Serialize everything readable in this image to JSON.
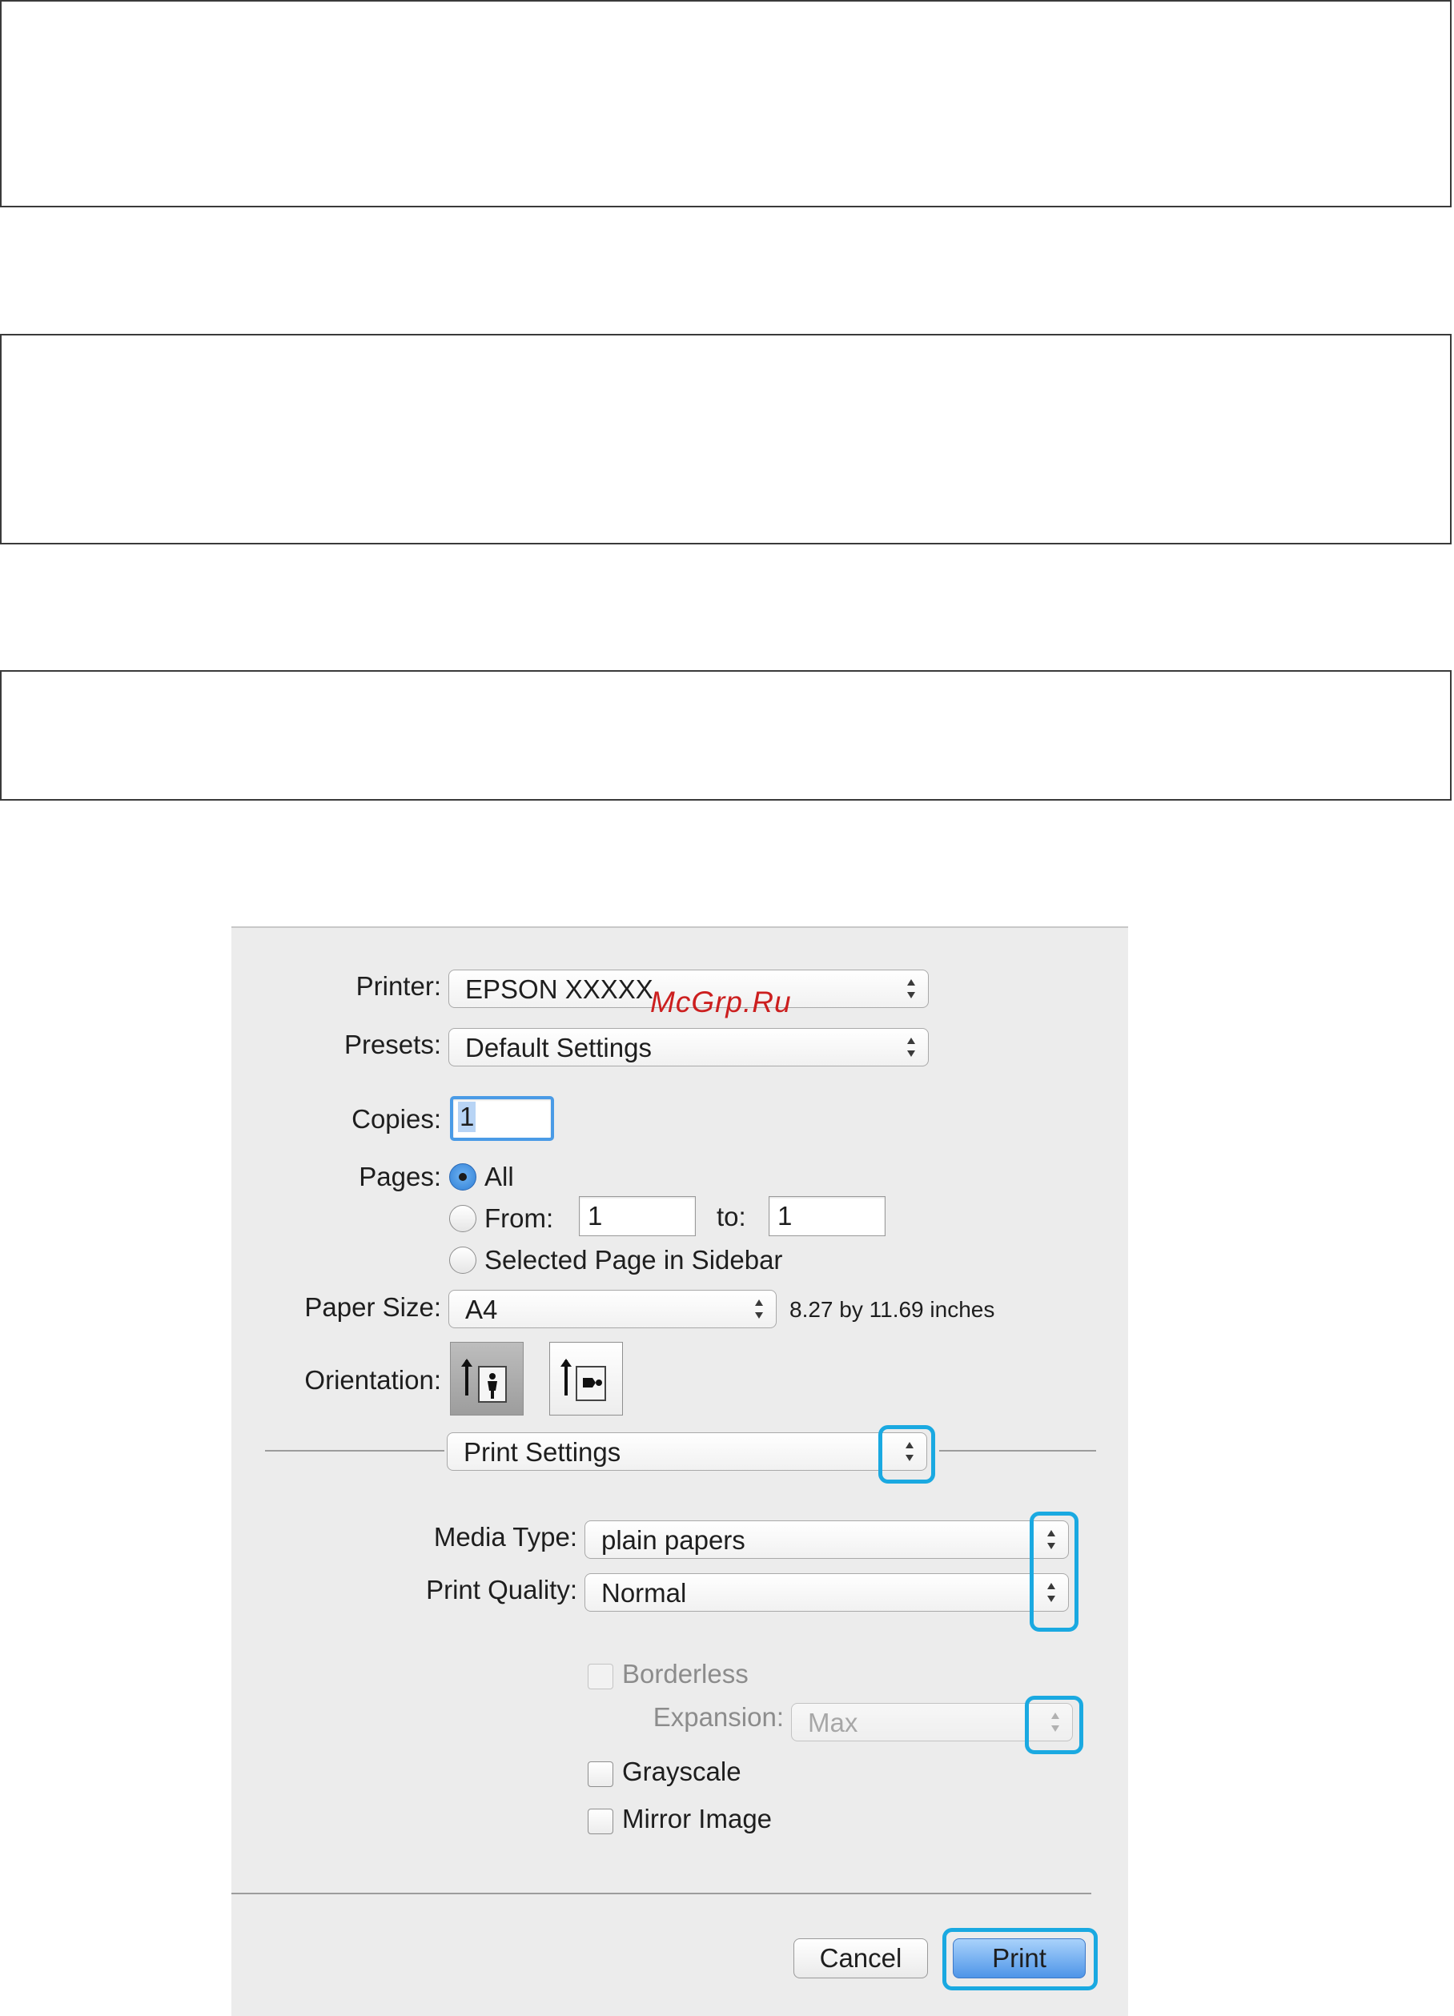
{
  "watermark": "McGrp.Ru",
  "dialog": {
    "printer": {
      "label": "Printer:",
      "value": "EPSON XXXXX"
    },
    "presets": {
      "label": "Presets:",
      "value": "Default Settings"
    },
    "copies": {
      "label": "Copies:",
      "value": "1"
    },
    "pages": {
      "label": "Pages:",
      "all": "All",
      "from_label": "From:",
      "from_value": "1",
      "to_label": "to:",
      "to_value": "1",
      "selected_sidebar": "Selected Page in Sidebar",
      "selected_option": "All"
    },
    "paper_size": {
      "label": "Paper Size:",
      "value": "A4",
      "dimensions": "8.27 by 11.69 inches"
    },
    "orientation": {
      "label": "Orientation:",
      "selected": "portrait"
    },
    "section_popup": {
      "value": "Print Settings"
    },
    "media_type": {
      "label": "Media Type:",
      "value": "plain papers"
    },
    "print_quality": {
      "label": "Print Quality:",
      "value": "Normal"
    },
    "borderless": {
      "label": "Borderless",
      "checked": false,
      "enabled": false
    },
    "expansion": {
      "label": "Expansion:",
      "value": "Max",
      "enabled": false
    },
    "grayscale": {
      "label": "Grayscale",
      "checked": false
    },
    "mirror_image": {
      "label": "Mirror Image",
      "checked": false
    },
    "buttons": {
      "cancel": "Cancel",
      "print": "Print"
    }
  },
  "colors": {
    "highlight": "#1aa9e1",
    "dialog_bg": "#ececec",
    "watermark": "#cc1f1f",
    "primary_button": "#4e95e8"
  }
}
